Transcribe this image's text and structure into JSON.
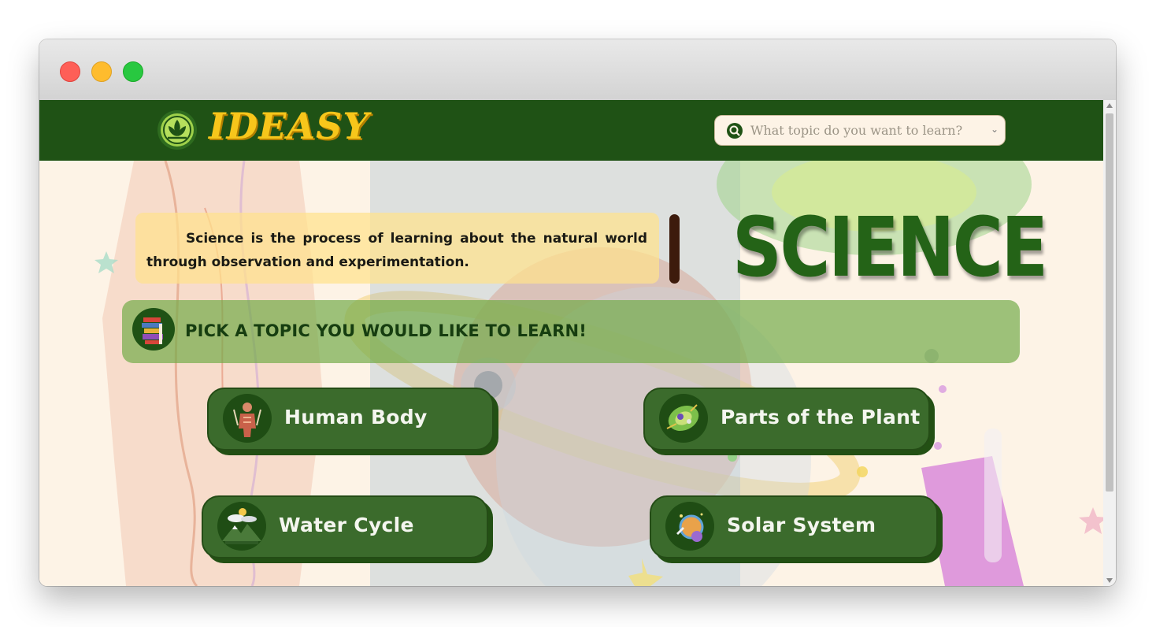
{
  "header": {
    "brand": "IDEASY",
    "search_placeholder": "What topic do you want to learn?"
  },
  "intro": {
    "text": "Science is the process of learning about the natural world through observation and experimentation.",
    "title": "SCIENCE"
  },
  "pick": {
    "label": "PICK A TOPIC YOU WOULD LIKE TO LEARN!"
  },
  "topics": [
    {
      "label": "Human Body",
      "icon": "human-body-icon"
    },
    {
      "label": "Parts of the Plant",
      "icon": "plant-icon"
    },
    {
      "label": "Water Cycle",
      "icon": "water-cycle-icon"
    },
    {
      "label": "Solar System",
      "icon": "solar-system-icon"
    }
  ],
  "colors": {
    "header_bg": "#1f5215",
    "brand_yellow": "#f7c61b",
    "button_green": "#3b6b2c",
    "page_bg": "#fdf3e6"
  }
}
